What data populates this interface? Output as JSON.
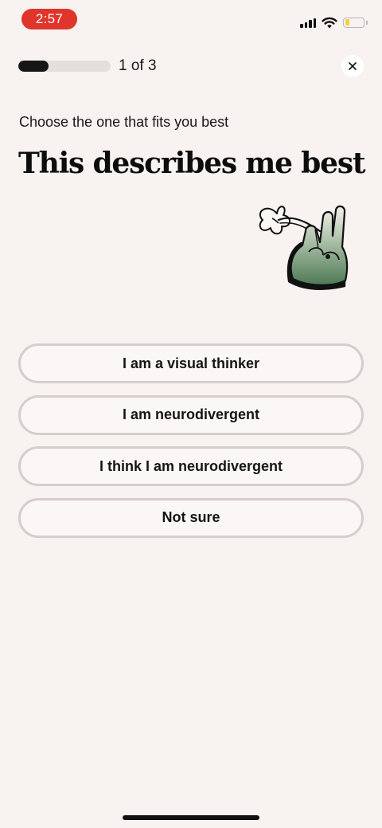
{
  "status_bar": {
    "time": "2:57",
    "time_pill_color": "#e0352b",
    "signal_icon": "cellular-signal-icon",
    "wifi_icon": "wifi-icon",
    "battery_icon": "battery-icon",
    "battery_level": 0.25,
    "battery_color": "#f2d23b"
  },
  "progress": {
    "label": "1 of 3",
    "fraction": 0.33
  },
  "close": {
    "icon": "close-icon"
  },
  "question": {
    "subtitle": "Choose the one that fits you best",
    "title": "This describes me best",
    "illustration_icon": "hand-holding-flower-illustration"
  },
  "options": [
    {
      "label": "I am a visual thinker"
    },
    {
      "label": "I am neurodivergent"
    },
    {
      "label": "I think I am neurodivergent"
    },
    {
      "label": "Not sure"
    }
  ],
  "colors": {
    "background": "#f8f2f1",
    "option_border": "#d5cecc",
    "progress_fill": "#161616",
    "progress_track": "#e3dfdd",
    "illustration_green": "#5f8a63"
  }
}
